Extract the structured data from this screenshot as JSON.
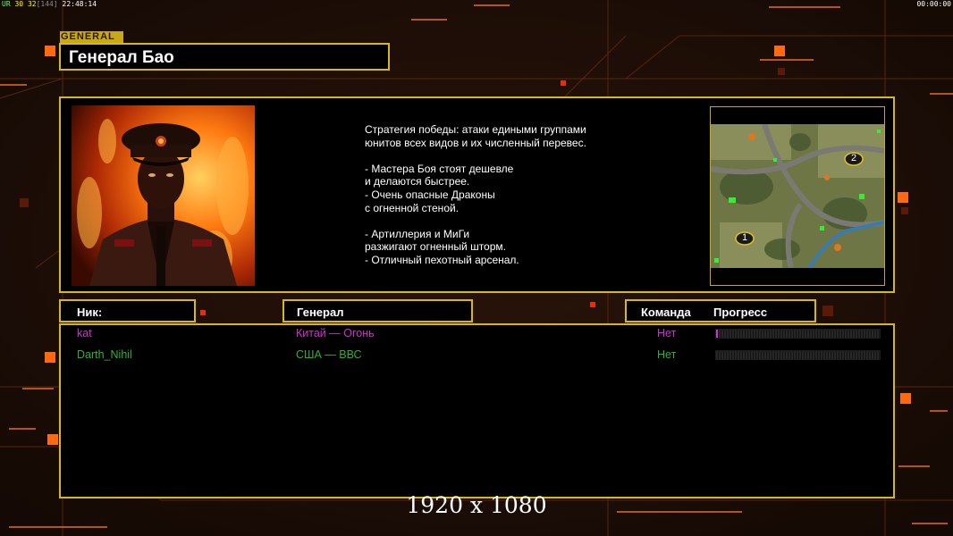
{
  "hud": {
    "top_left_ur": "UR",
    "top_left_fps": "30",
    "top_left_fps2": "32",
    "top_left_cap": "[144]",
    "top_left_time": "22:48:14",
    "top_right_timer": "00:00:00"
  },
  "header": {
    "tag": "GENERAL",
    "title": "Генерал Бао"
  },
  "description": "Стратегия победы: атаки едиными группами\nюнитов всех видов и их численный перевес.\n\n- Мастера Боя стоят дешевле\nи делаются быстрее.\n- Очень опасные Драконы\nс огненной стеной.\n\n- Артиллерия и МиГи\nразжигают огненный шторм.\n- Отличный пехотный арсенал.",
  "minimap": {
    "marker_1": "1",
    "marker_2": "2"
  },
  "columns": {
    "nick": "Ник:",
    "general": "Генерал",
    "team": "Команда",
    "progress": "Прогресс"
  },
  "players": [
    {
      "nick": "kat",
      "general": "Китай — Огонь",
      "team": "Нет",
      "color": "#cc33cc",
      "progress": 0.01
    },
    {
      "nick": "Darth_Nihil",
      "general": "США — ВВС",
      "team": "Нет",
      "color": "#33b033",
      "progress": 0
    }
  ],
  "resolution": "1920 x 1080",
  "colors": {
    "accent": "#d8b814",
    "background": "#1a0d06",
    "highlight": "#ff6a10"
  }
}
